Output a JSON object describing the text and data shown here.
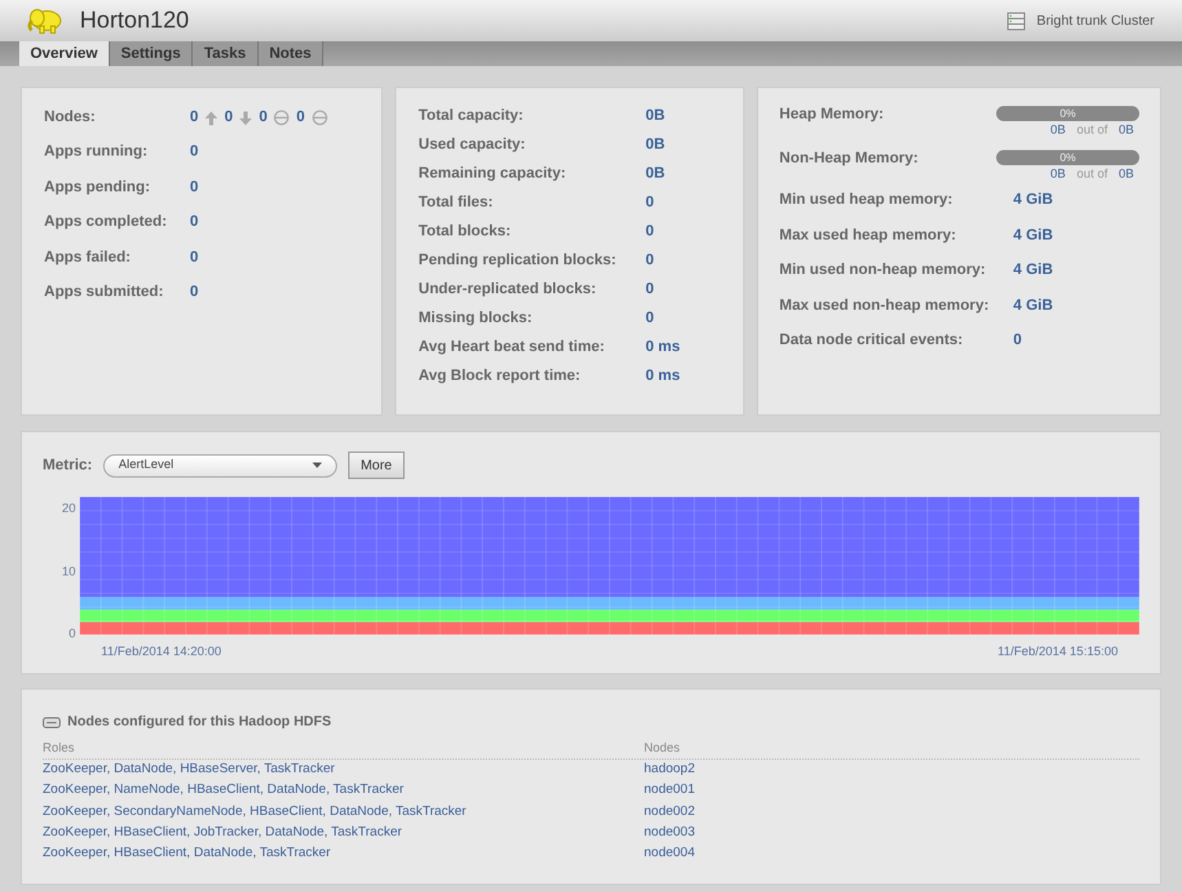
{
  "header": {
    "title": "Horton120",
    "cluster": "Bright trunk Cluster"
  },
  "tabs": [
    {
      "label": "Overview",
      "selected": true
    },
    {
      "label": "Settings",
      "selected": false
    },
    {
      "label": "Tasks",
      "selected": false
    },
    {
      "label": "Notes",
      "selected": false
    }
  ],
  "nodes": {
    "label": "Nodes:",
    "counts": [
      {
        "value": "0",
        "kind": "up"
      },
      {
        "value": "0",
        "kind": "down"
      },
      {
        "value": "0",
        "kind": "closed"
      },
      {
        "value": "0",
        "kind": "closed"
      }
    ]
  },
  "apps": [
    {
      "label": "Apps running:",
      "value": "0"
    },
    {
      "label": "Apps pending:",
      "value": "0"
    },
    {
      "label": "Apps completed:",
      "value": "0"
    },
    {
      "label": "Apps failed:",
      "value": "0"
    },
    {
      "label": "Apps submitted:",
      "value": "0"
    }
  ],
  "storage": [
    {
      "label": "Total capacity:",
      "value": "0B"
    },
    {
      "label": "Used capacity:",
      "value": "0B"
    },
    {
      "label": "Remaining capacity:",
      "value": "0B"
    },
    {
      "label": "Total files:",
      "value": "0"
    },
    {
      "label": "Total blocks:",
      "value": "0"
    },
    {
      "label": "Pending replication blocks:",
      "value": "0"
    },
    {
      "label": "Under-replicated blocks:",
      "value": "0"
    },
    {
      "label": "Missing blocks:",
      "value": "0"
    },
    {
      "label": "Avg Heart beat send time:",
      "value": "0 ms"
    },
    {
      "label": "Avg Block report time:",
      "value": "0 ms"
    }
  ],
  "memory_bars": [
    {
      "label": "Heap Memory:",
      "level": 0,
      "percent": "0%",
      "used": "0B",
      "separator": "out of",
      "total": "0B"
    },
    {
      "label": "Non-Heap Memory:",
      "level": 0,
      "percent": "0%",
      "used": "0B",
      "separator": "out of",
      "total": "0B"
    }
  ],
  "memory": [
    {
      "label": "Min used heap memory:",
      "value": "4 GiB"
    },
    {
      "label": "Max used heap memory:",
      "value": "4 GiB"
    },
    {
      "label": "Min used non-heap memory:",
      "value": "4 GiB"
    },
    {
      "label": "Max used non-heap memory:",
      "value": "4 GiB"
    },
    {
      "label": "Data node critical events:",
      "value": "0"
    }
  ],
  "metric": {
    "label": "Metric:",
    "value": "AlertLevel",
    "button": "More",
    "chart_data": {
      "type": "area",
      "stacked": true,
      "grid": true,
      "categories": [
        null,
        "11/Feb/2014 14:20:00",
        null,
        null,
        null,
        null,
        null,
        null,
        null,
        null,
        null,
        null,
        "11/Feb/2014 15:15:00",
        null
      ],
      "ylim": [
        0,
        22
      ],
      "yticks": [
        0,
        10,
        20
      ],
      "series": [
        {
          "color": "#ff6b6b",
          "values": [
            2,
            2,
            2,
            2,
            2,
            2,
            2,
            2,
            2,
            2,
            2,
            2,
            2,
            2
          ]
        },
        {
          "color": "#6bff6b",
          "values": [
            2,
            2,
            2,
            2,
            2,
            2,
            2,
            2,
            2,
            2,
            2,
            2,
            2,
            2
          ]
        },
        {
          "color": "#6bbaff",
          "values": [
            2,
            2,
            2,
            2,
            2,
            2,
            2,
            2,
            2,
            2,
            2,
            2,
            2,
            2
          ]
        },
        {
          "color": "#6b6bff",
          "values": [
            16,
            16,
            16,
            16,
            16,
            16,
            16,
            16,
            16,
            16,
            16,
            16,
            16,
            16
          ]
        }
      ]
    }
  },
  "nodes_table": {
    "title": "Nodes configured for this Hadoop HDFS",
    "columns": [
      "Roles",
      "Nodes"
    ],
    "rows": [
      [
        "ZooKeeper, DataNode, HBaseServer, TaskTracker",
        "hadoop2"
      ],
      [
        "ZooKeeper, NameNode, HBaseClient, DataNode, TaskTracker",
        "node001"
      ],
      [
        "ZooKeeper, SecondaryNameNode, HBaseClient, DataNode, TaskTracker",
        "node002"
      ],
      [
        "ZooKeeper, HBaseClient, JobTracker, DataNode, TaskTracker",
        "node003"
      ],
      [
        "ZooKeeper, HBaseClient, DataNode, TaskTracker",
        "node004"
      ]
    ]
  }
}
